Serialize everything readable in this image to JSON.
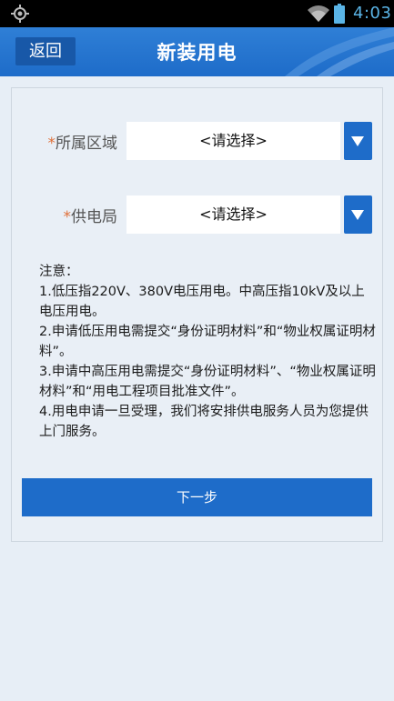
{
  "status_bar": {
    "time": "4:03",
    "icons": [
      "gps-icon",
      "wifi-icon",
      "battery-icon"
    ],
    "time_color": "#5ab4e6"
  },
  "header": {
    "back_label": "返回",
    "title": "新装用电",
    "color": "#1e6cc9"
  },
  "form": {
    "region": {
      "required_mark": "*",
      "label": "所属区域",
      "value": "<请选择>"
    },
    "bureau": {
      "required_mark": "*",
      "label": "供电局",
      "value": "<请选择>"
    }
  },
  "notice": {
    "heading": "注意：",
    "items": [
      "1.低压指220V、380V电压用电。中高压指10kV及以上电压用电。",
      "2.申请低压用电需提交“身份证明材料”和“物业权属证明材料”。",
      "3.申请中高压用电需提交“身份证明材料”、“物业权属证明材料”和“用电工程项目批准文件”。",
      "4.用电申请一旦受理，我们将安排供电服务人员为您提供上门服务。"
    ]
  },
  "actions": {
    "next_label": "下一步"
  },
  "colors": {
    "accent": "#1e6cc9",
    "required": "#e0703a",
    "background": "#e7eef6"
  }
}
